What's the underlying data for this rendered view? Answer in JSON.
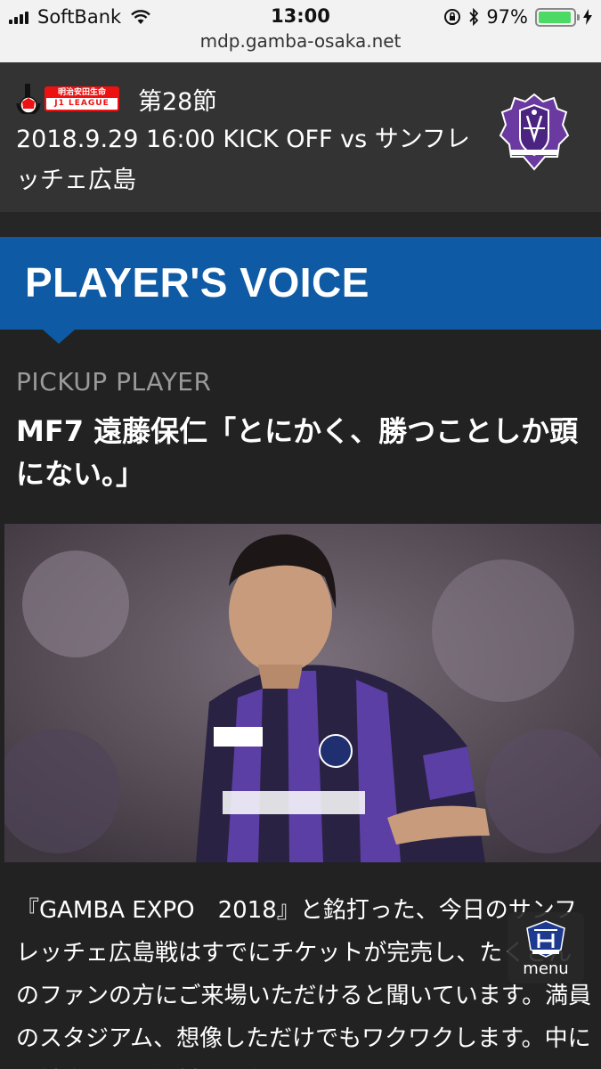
{
  "status_bar": {
    "carrier": "SoftBank",
    "time": "13:00",
    "battery": "97%",
    "battery_level": 0.97,
    "url": "mdp.gamba-osaka.net"
  },
  "match": {
    "league_logo_top": "明治安田生命",
    "league_logo_bottom": "J1 LEAGUE",
    "round": "第28節",
    "kickoff": "2018.9.29 16:00 KICK OFF vs サンフレッチェ広島",
    "opponent_crest_icon": "sanfrecce-hiroshima-crest-icon"
  },
  "banner": {
    "title": "PLAYER'S VOICE",
    "color": "#0f5aa5"
  },
  "article": {
    "kicker": "PICKUP PLAYER",
    "headline": "MF7 遠藤保仁「とにかく、勝つことしか頭にない。」",
    "body": "『GAMBA EXPO　2018』と銘打った、今日のサンフレッチェ広島戦はすでにチケットが完売し、たくさんのファンの方にご来場いただけると聞いています。満員のスタジアム、想像しただけでもワクワクします。中には試合より、無料で配布"
  },
  "menu": {
    "label": "menu",
    "icon": "gamba-osaka-emblem-icon"
  }
}
